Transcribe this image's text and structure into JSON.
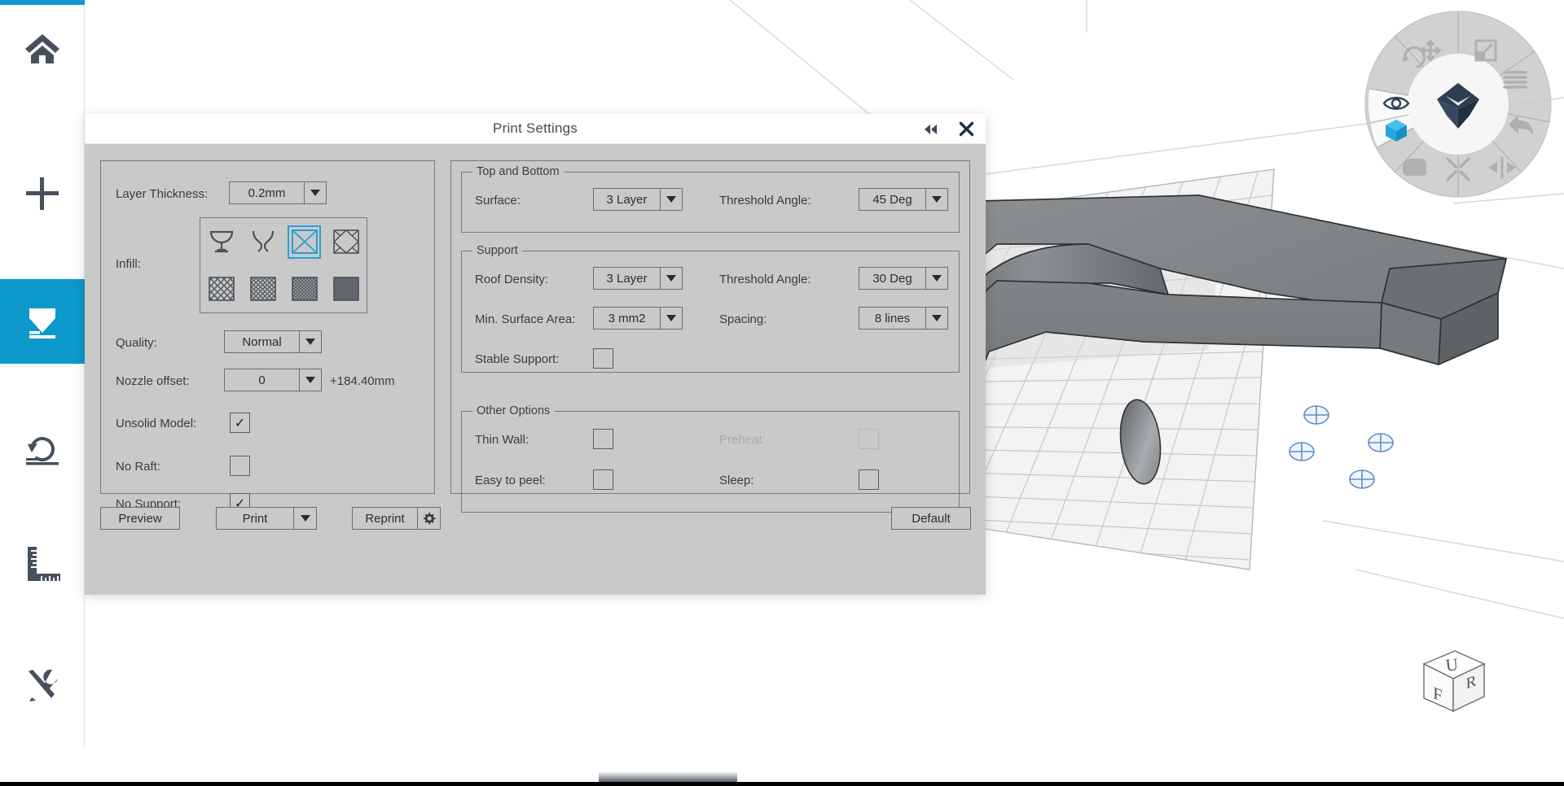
{
  "theme": {
    "accent": "#0d99cc",
    "dialog_bg": "#c9c9c9",
    "titlebar_bg": "#ffffff",
    "viewport_bg": "#efefef",
    "selection_blue": "#2a9fd6",
    "model_gray": "#8a8d90"
  },
  "sidebar": {
    "items": [
      {
        "icon": "home-icon",
        "name": "sidebar-item-home",
        "active": false
      },
      {
        "icon": "plus-icon",
        "name": "sidebar-item-add",
        "active": false
      },
      {
        "icon": "print-icon",
        "name": "sidebar-item-print",
        "active": true
      },
      {
        "icon": "rotate-icon",
        "name": "sidebar-item-rotate",
        "active": false
      },
      {
        "icon": "ruler-icon",
        "name": "sidebar-item-measure",
        "active": false
      },
      {
        "icon": "tools-icon",
        "name": "sidebar-item-tools",
        "active": false
      }
    ]
  },
  "dialog": {
    "title": "Print Settings",
    "collapse_icon": "collapse-left-icon",
    "close_icon": "close-icon",
    "left_panel": {
      "layer_thickness": {
        "label": "Layer Thickness:",
        "value": "0.2mm"
      },
      "infill": {
        "label": "Infill:",
        "selected_index": 2,
        "patterns": [
          {
            "name": "infill-hollow-thick",
            "type": "cup-wide"
          },
          {
            "name": "infill-hollow-thin",
            "type": "cup-narrow"
          },
          {
            "name": "infill-cross",
            "type": "cross"
          },
          {
            "name": "infill-diamond",
            "type": "diamond"
          },
          {
            "name": "infill-grid-sparse",
            "type": "hatch",
            "density": 7
          },
          {
            "name": "infill-grid-medium",
            "type": "hatch",
            "density": 5
          },
          {
            "name": "infill-grid-dense",
            "type": "hatch",
            "density": 3.5
          },
          {
            "name": "infill-grid-solid",
            "type": "hatch",
            "density": 2.5
          }
        ]
      },
      "quality": {
        "label": "Quality:",
        "value": "Normal"
      },
      "nozzle_offset": {
        "label": "Nozzle offset:",
        "value": "0",
        "suffix": "+184.40mm"
      },
      "unsolid_model": {
        "label": "Unsolid Model:",
        "checked": true
      },
      "no_raft": {
        "label": "No Raft:",
        "checked": false
      },
      "no_support": {
        "label": "No Support:",
        "checked": true
      }
    },
    "top_and_bottom": {
      "legend": "Top and Bottom",
      "surface": {
        "label": "Surface:",
        "value": "3 Layer"
      },
      "threshold_angle": {
        "label": "Threshold Angle:",
        "value": "45 Deg"
      }
    },
    "support": {
      "legend": "Support",
      "roof_density": {
        "label": "Roof Density:",
        "value": "3 Layer"
      },
      "threshold_angle": {
        "label": "Threshold Angle:",
        "value": "30 Deg"
      },
      "min_surface_area": {
        "label": "Min. Surface Area:",
        "value": "3 mm2"
      },
      "spacing": {
        "label": "Spacing:",
        "value": "8 lines"
      },
      "stable_support": {
        "label": "Stable Support:",
        "checked": false
      }
    },
    "other_options": {
      "legend": "Other Options",
      "thin_wall": {
        "label": "Thin Wall:",
        "checked": false,
        "disabled": false
      },
      "preheat": {
        "label": "Preheat:",
        "checked": false,
        "disabled": true
      },
      "easy_to_peel": {
        "label": "Easy to peel:",
        "checked": false,
        "disabled": false
      },
      "sleep": {
        "label": "Sleep:",
        "checked": false,
        "disabled": false
      }
    },
    "buttons": {
      "preview": "Preview",
      "print": "Print",
      "reprint": "Reprint",
      "reprint_icon": "gear-icon",
      "default": "Default"
    }
  },
  "nav_wheel": {
    "center_icon": "orbit-gem-icon",
    "segments": [
      {
        "name": "nav-move-icon",
        "icon": "move",
        "active": false
      },
      {
        "name": "nav-scale-icon",
        "icon": "scale",
        "active": false
      },
      {
        "name": "nav-layers-icon",
        "icon": "layers",
        "active": false
      },
      {
        "name": "nav-undo-icon",
        "icon": "undo",
        "active": false
      },
      {
        "name": "nav-mirror-icon",
        "icon": "mirror",
        "active": false
      },
      {
        "name": "nav-collapse-icon",
        "icon": "collapse",
        "active": false
      },
      {
        "name": "nav-pan-icon",
        "icon": "pan",
        "active": false
      },
      {
        "name": "nav-cube-icon",
        "icon": "cube",
        "active": true
      },
      {
        "name": "nav-eye-icon",
        "icon": "eye",
        "active": true
      },
      {
        "name": "nav-rotate-icon",
        "icon": "rotate",
        "active": false
      }
    ]
  },
  "view_cube": {
    "top_face": "U",
    "front_face": "F",
    "right_face": "R"
  },
  "build_plate": {
    "calibration_markers": 4,
    "grid": true
  }
}
